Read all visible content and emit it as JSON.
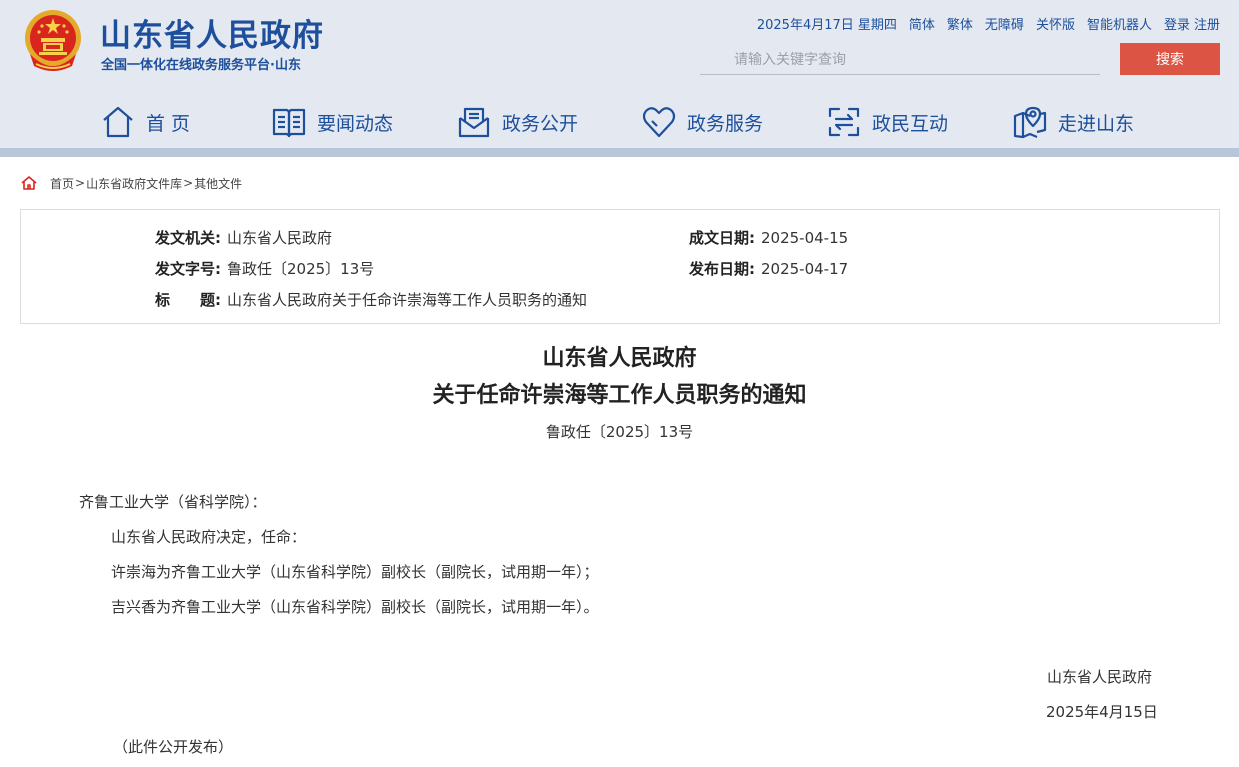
{
  "header": {
    "title": "山东省人民政府",
    "subtitle": "全国一体化在线政务服务平台·山东",
    "date": "2025年4月17日 星期四",
    "links": {
      "simplified": "简体",
      "traditional": "繁体",
      "accessibility": "无障碍",
      "care": "关怀版",
      "robot": "智能机器人",
      "login": "登录",
      "register": "注册"
    },
    "search": {
      "placeholder": "请输入关键字查询",
      "button": "搜索"
    }
  },
  "nav": {
    "items": [
      {
        "label": "首 页",
        "icon": "home-icon"
      },
      {
        "label": "要闻动态",
        "icon": "book-icon"
      },
      {
        "label": "政务公开",
        "icon": "mail-icon"
      },
      {
        "label": "政务服务",
        "icon": "heart-icon"
      },
      {
        "label": "政民互动",
        "icon": "interaction-icon"
      },
      {
        "label": "走进山东",
        "icon": "map-pin-icon"
      }
    ]
  },
  "breadcrumb": {
    "home": "首页",
    "sep1": ">",
    "library": "山东省政府文件库",
    "sep2": ">",
    "current": "其他文件"
  },
  "meta": {
    "issuer_label": "发文机关:",
    "issuer": "山东省人民政府",
    "doc_no_label": "发文字号:",
    "doc_no": "鲁政任〔2025〕13号",
    "title_label": "标　　题:",
    "title": "山东省人民政府关于任命许崇海等工作人员职务的通知",
    "written_label": "成文日期:",
    "written": "2025-04-15",
    "published_label": "发布日期:",
    "published": "2025-04-17"
  },
  "document": {
    "title_line1": "山东省人民政府",
    "title_line2": "关于任命许崇海等工作人员职务的通知",
    "number": "鲁政任〔2025〕13号",
    "addressee": "齐鲁工业大学（省科学院）：",
    "para1": "山东省人民政府决定，任命：",
    "para2": "许崇海为齐鲁工业大学（山东省科学院）副校长（副院长，试用期一年）；",
    "para3": "吉兴香为齐鲁工业大学（山东省科学院）副校长（副院长，试用期一年）。",
    "signature": "山东省人民政府",
    "sign_date": "2025年4月15日",
    "note": "（此件公开发布）"
  },
  "colors": {
    "brand_blue": "#1d4f9c",
    "search_red": "#dc5544",
    "header_bg": "#e4e9f1"
  }
}
